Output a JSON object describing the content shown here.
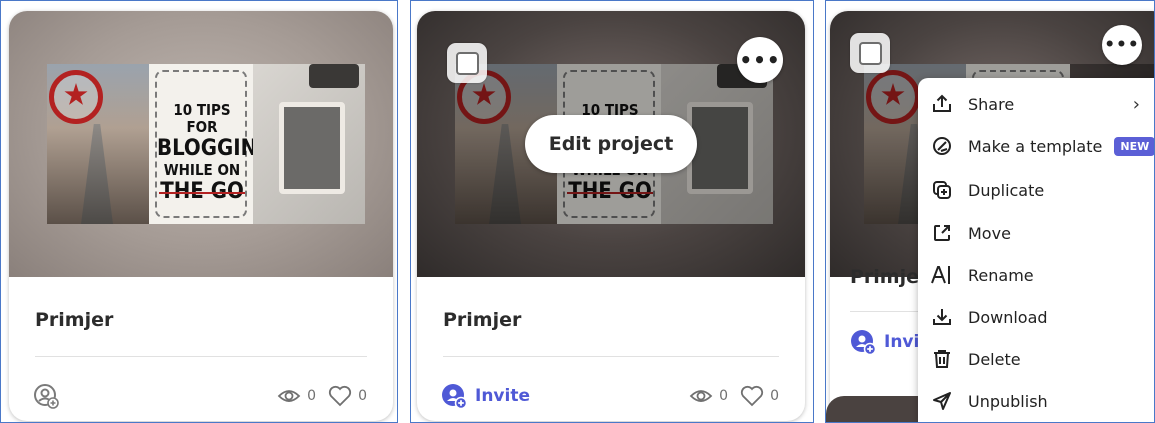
{
  "cards": [
    {
      "title": "Primjer",
      "views": "0",
      "likes": "0",
      "state": "idle"
    },
    {
      "title": "Primjer",
      "views": "0",
      "likes": "0",
      "state": "hover",
      "invite_label": "Invite",
      "edit_label": "Edit project"
    },
    {
      "title": "Primjer",
      "invite_label": "Invite",
      "state": "menu-open"
    }
  ],
  "cover": {
    "line1": "10 TIPS FOR",
    "line2": "BLOGGING",
    "line3": "WHILE ON",
    "line4": "THE GO"
  },
  "more_glyph": "•••",
  "menu": {
    "items": [
      {
        "label": "Share",
        "icon": "share-icon",
        "has_submenu": true
      },
      {
        "label": "Make a template",
        "icon": "template-icon",
        "badge": "NEW"
      },
      {
        "label": "Duplicate",
        "icon": "duplicate-icon"
      },
      {
        "label": "Move",
        "icon": "move-icon"
      },
      {
        "label": "Rename",
        "icon": "rename-icon"
      },
      {
        "label": "Download",
        "icon": "download-icon"
      },
      {
        "label": "Delete",
        "icon": "delete-icon"
      },
      {
        "label": "Unpublish",
        "icon": "unpublish-icon"
      }
    ],
    "chevron": "›"
  },
  "colors": {
    "accent": "#4f59d6",
    "badge": "#5b5fd6",
    "panel_border": "#4a78c8"
  }
}
